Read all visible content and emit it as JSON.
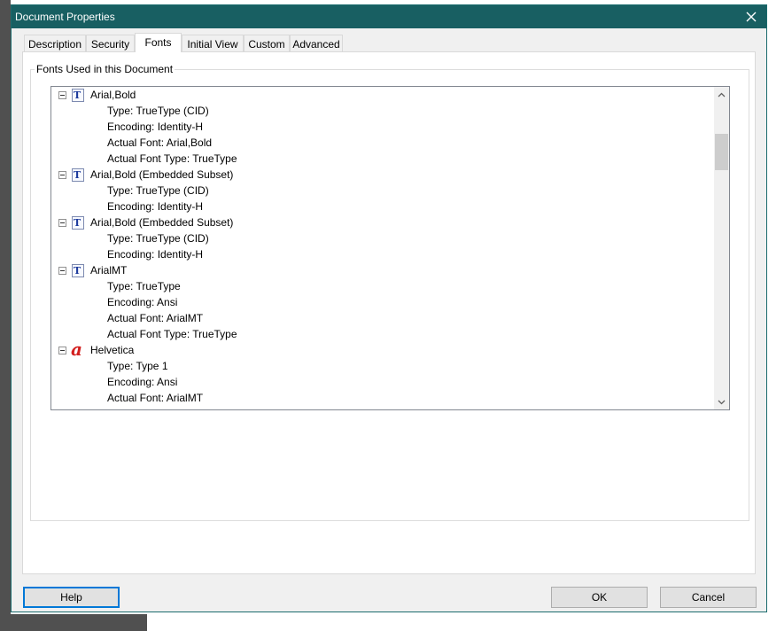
{
  "dialog": {
    "title": "Document Properties",
    "close_icon": "close-icon"
  },
  "tabs": [
    {
      "label": "Description",
      "active": false
    },
    {
      "label": "Security",
      "active": false
    },
    {
      "label": "Fonts",
      "active": true
    },
    {
      "label": "Initial View",
      "active": false
    },
    {
      "label": "Custom",
      "active": false
    },
    {
      "label": "Advanced",
      "active": false
    }
  ],
  "fonts_group": {
    "label": "Fonts Used in this Document",
    "fonts": [
      {
        "name": "Arial,Bold",
        "icon": "truetype-font-icon",
        "properties": [
          "Type: TrueType (CID)",
          "Encoding: Identity-H",
          "Actual Font: Arial,Bold",
          "Actual Font Type: TrueType"
        ]
      },
      {
        "name": "Arial,Bold (Embedded Subset)",
        "icon": "truetype-font-icon",
        "properties": [
          "Type: TrueType (CID)",
          "Encoding: Identity-H"
        ]
      },
      {
        "name": "Arial,Bold (Embedded Subset)",
        "icon": "truetype-font-icon",
        "properties": [
          "Type: TrueType (CID)",
          "Encoding: Identity-H"
        ]
      },
      {
        "name": "ArialMT",
        "icon": "truetype-font-icon",
        "properties": [
          "Type: TrueType",
          "Encoding: Ansi",
          "Actual Font: ArialMT",
          "Actual Font Type: TrueType"
        ]
      },
      {
        "name": "Helvetica",
        "icon": "type1-font-icon",
        "properties": [
          "Type: Type 1",
          "Encoding: Ansi",
          "Actual Font: ArialMT"
        ]
      }
    ]
  },
  "buttons": {
    "help": "Help",
    "ok": "OK",
    "cancel": "Cancel"
  },
  "colors": {
    "titlebar": "#185f62",
    "focus_border": "#0078d7",
    "type1_icon": "#d3201f"
  }
}
